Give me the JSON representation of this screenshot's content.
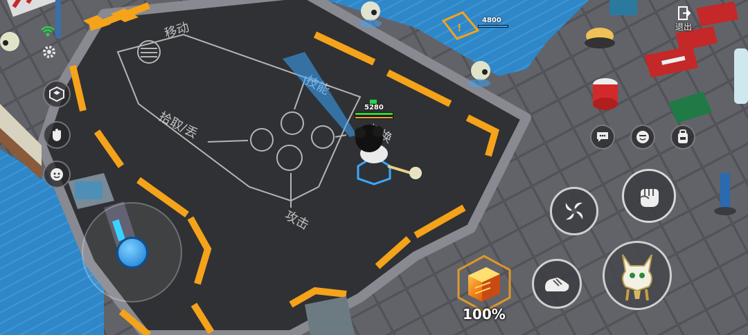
{
  "hud": {
    "exit_label": "退出",
    "player_hp": "5280",
    "enemy_hp": "4800",
    "charge_percent": "100%"
  },
  "floor_chalk": {
    "move": "移动",
    "skill": "技能",
    "pickup": "拾取/丢",
    "switch": "切换",
    "attack": "攻击"
  },
  "icons": {
    "wifi": "wifi-icon",
    "settings": "gear-icon",
    "exit": "exit-door-icon",
    "chat": "chat-bubble-icon",
    "emote": "smiley-icon",
    "bag": "backpack-icon",
    "punch": "fist-icon",
    "spin": "whirlwind-icon",
    "slide": "shoe-icon",
    "character": "pet-portrait-icon",
    "charge": "treasure-box-icon"
  },
  "colors": {
    "hp_green": "#35d33b",
    "hp_orange": "#ff9b2a",
    "joystick_blue": "#2aa0f0",
    "road_stripe": "#f5a31a"
  }
}
